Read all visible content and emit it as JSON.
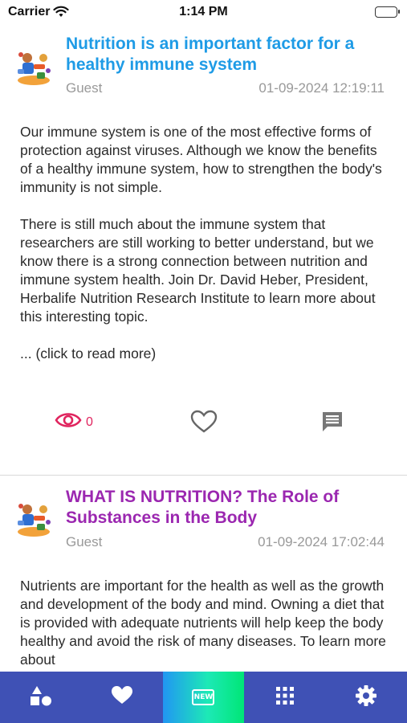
{
  "status_bar": {
    "carrier": "Carrier",
    "time": "1:14 PM"
  },
  "posts": [
    {
      "title": "Nutrition is an important factor for a healthy immune system",
      "author": "Guest",
      "timestamp": "01-09-2024 12:19:11",
      "paragraphs": [
        "Our immune system is one of the most effective forms of protection against viruses. Although we know the benefits of a healthy immune system, how to strengthen the body's immunity is not simple.",
        "There is still much about the immune system that researchers are still working to better understand, but we know there is a strong connection between nutrition and immune system health. Join Dr. David Heber, President, Herbalife Nutrition Research Institute to learn more about this interesting topic.",
        "... (click to read more)"
      ],
      "views": "0",
      "title_color": "#1e9be6"
    },
    {
      "title": "WHAT IS NUTRITION? The Role of Substances in the Body",
      "author": "Guest",
      "timestamp": "01-09-2024 17:02:44",
      "paragraphs": [
        "Nutrients are important for the health as well as the growth and development of the body and mind. Owning a diet that is provided with adequate nutrients will help keep the body healthy and avoid the risk of many diseases. To learn more about"
      ],
      "title_color": "#9b27b0"
    }
  ],
  "tab_bar": {
    "items": [
      {
        "icon": "shapes-icon"
      },
      {
        "icon": "heart-icon"
      },
      {
        "icon": "new-icon",
        "label": "NEW",
        "active": true
      },
      {
        "icon": "grid-icon"
      },
      {
        "icon": "gear-icon"
      }
    ],
    "background": "#3f51b5"
  },
  "colors": {
    "views_accent": "#e0245e",
    "meta_gray": "#999999"
  }
}
